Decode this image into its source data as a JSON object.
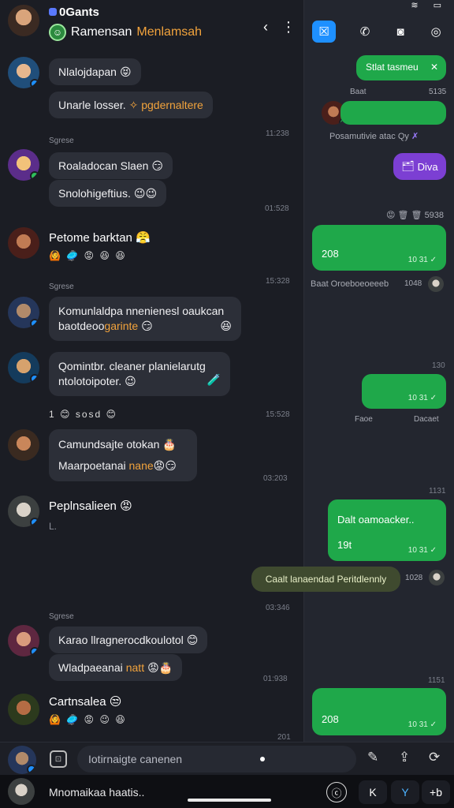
{
  "header": {
    "app_name": "0Gants",
    "chat_title": "Ramensan",
    "chat_subtitle": "Menlamsah",
    "back_glyph": "‹",
    "more_glyph": "⋮"
  },
  "right_header": {
    "status_icons": "≋ ▭",
    "buttons": [
      {
        "icon": "contact-icon",
        "glyph": "☒"
      },
      {
        "icon": "phone-icon",
        "glyph": "✆"
      },
      {
        "icon": "video-icon",
        "glyph": "◙"
      },
      {
        "icon": "circle-icon",
        "glyph": "◎"
      }
    ]
  },
  "left_messages": {
    "m1": {
      "text": "Nlalojdapan",
      "emoji": "😝"
    },
    "m2": {
      "text": "Unarle losser.",
      "accent": "✧ pgdernaltere"
    },
    "label1": "Sgrese",
    "ts1": "11:238",
    "m3": {
      "text": "Roaladocan Slaen",
      "emoji": "😏"
    },
    "m4": {
      "text": "Snolohigeftius.",
      "emoji": "😉😉"
    },
    "ts2": "01:528",
    "m5_name": "Petome barktan",
    "m5_emoji": "😤",
    "reacts1": "🙆 🥏 😡 😆 😆",
    "label2": "Sgrese",
    "ts3": "15:328",
    "m6": {
      "line1": "Komunlaldpa nnenienesl oaukcan",
      "line2a": "baotdeoo",
      "line2b": "garinte",
      "emoji": "😏",
      "emoji2": "😆"
    },
    "m7": {
      "line1": "Qomintbr. cleaner planielarutg",
      "line2": "ntolotoipoter.",
      "emoji": "😉",
      "emoji2": "🧪"
    },
    "reacts2": "1 😊 sosd 😊",
    "ts4": "15:528",
    "m8": {
      "line1": "Camundsajte otokan",
      "emoji1": "🎂",
      "line2a": "Maarpoetanai",
      "line2b": "nane",
      "emoji2": "😡😏"
    },
    "ts5": "03:203",
    "m9_name": "Peplnsalieen",
    "m9_emoji": "😡",
    "m9_sub": "L.",
    "label3": "Sgrese",
    "ts6": "03:346",
    "m10": {
      "text": "Karao llragnerocdkoulotol",
      "emoji": "😊"
    },
    "m11": {
      "text": "Wladpaeanai",
      "accent": "natt",
      "emoji": "😡🎂"
    },
    "ts7": "01:938",
    "m12_name": "Cartnsalea",
    "m12_emoji": "😒",
    "reacts3": "🙆 🥏 😡 😉 😆",
    "ts8": "201"
  },
  "right_messages": {
    "g1": {
      "text": "Stlat tasmeu",
      "icon": "✕"
    },
    "g1_meta_left": "Baat",
    "g1_meta_right": "5135",
    "g2_meta": "Posamutivie atac  Qy",
    "g2_meta_icon": "✗",
    "purple_label": "Diva",
    "purple_glyph": "🗂",
    "status_line": "😡 🗑 🗑 5938",
    "g3": {
      "value": "208",
      "meta": "10 31"
    },
    "g3_caption": "Baat Oroeboeoeeeb",
    "g3_caption_ts": "1048",
    "ts_a": "130",
    "g4_meta": "10 31",
    "g4_caption_left": "Faoe",
    "g4_caption_right": "Dacaet",
    "ts_b": "1131",
    "g5": {
      "text": "Dalt oamoacker..",
      "value": "19t",
      "meta": "10 31"
    },
    "olive_label": "Caalt lanaendad Peritdlennly",
    "olive_ts": "1028",
    "ts_c": "1151",
    "g6": {
      "value": "208",
      "meta": "10 31"
    }
  },
  "composer": {
    "placeholder": "Iotirnaigte canenen",
    "attach_glyph": "⊡",
    "icons": [
      {
        "name": "pencil-icon",
        "glyph": "✎"
      },
      {
        "name": "share-icon",
        "glyph": "⇪"
      },
      {
        "name": "refresh-icon",
        "glyph": "⟳"
      }
    ]
  },
  "bottom_bar": {
    "label": "Mnomaikaa haatis..",
    "icons": [
      {
        "name": "clock-icon",
        "glyph": "ⓒ"
      },
      {
        "name": "k-icon",
        "glyph": "K"
      },
      {
        "name": "y-icon",
        "glyph": "Y"
      },
      {
        "name": "b-icon",
        "glyph": "+b"
      }
    ]
  },
  "colors": {
    "green": "#1fa84a",
    "purple": "#7c3fd3",
    "accent_orange": "#f2a33c",
    "blue_button": "#1e90ff"
  }
}
